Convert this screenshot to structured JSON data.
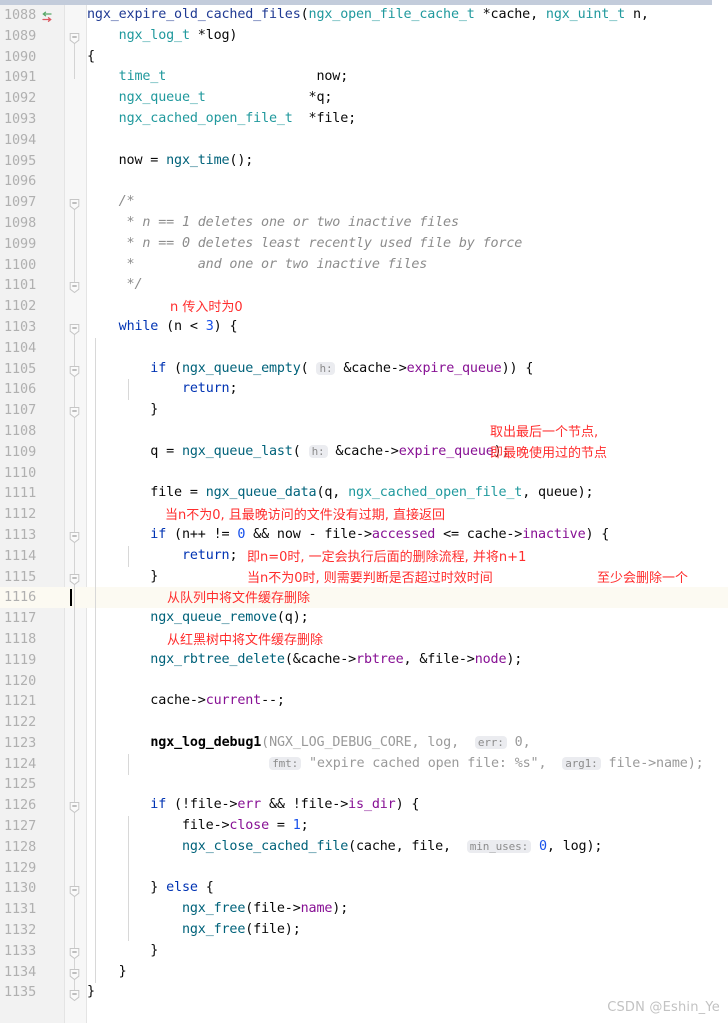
{
  "editor": {
    "language": "C",
    "watermark": "CSDN @Eshin_Ye",
    "first_line_number": 1088,
    "current_line_number": 1116,
    "gutter_icon": "show-usages-arrows-icon"
  },
  "lines": [
    {
      "n": "1088",
      "text": "ngx_expire_old_cached_files(ngx_open_file_cache_t *cache, ngx_uint_t n,"
    },
    {
      "n": "1089",
      "text": "    ngx_log_t *log)"
    },
    {
      "n": "1090",
      "text": "{"
    },
    {
      "n": "1091",
      "text": "    time_t                   now;"
    },
    {
      "n": "1092",
      "text": "    ngx_queue_t             *q;"
    },
    {
      "n": "1093",
      "text": "    ngx_cached_open_file_t  *file;"
    },
    {
      "n": "1094",
      "text": ""
    },
    {
      "n": "1095",
      "text": "    now = ngx_time();"
    },
    {
      "n": "1096",
      "text": ""
    },
    {
      "n": "1097",
      "text": "    /*"
    },
    {
      "n": "1098",
      "text": "     * n == 1 deletes one or two inactive files"
    },
    {
      "n": "1099",
      "text": "     * n == 0 deletes least recently used file by force"
    },
    {
      "n": "1100",
      "text": "     *        and one or two inactive files"
    },
    {
      "n": "1101",
      "text": "     */"
    },
    {
      "n": "1102",
      "text": ""
    },
    {
      "n": "1103",
      "text": "    while (n < 3) {"
    },
    {
      "n": "1104",
      "text": ""
    },
    {
      "n": "1105",
      "text": "        if (ngx_queue_empty( h: &cache->expire_queue)) {"
    },
    {
      "n": "1106",
      "text": "            return;"
    },
    {
      "n": "1107",
      "text": "        }"
    },
    {
      "n": "1108",
      "text": ""
    },
    {
      "n": "1109",
      "text": "        q = ngx_queue_last( h: &cache->expire_queue);"
    },
    {
      "n": "1110",
      "text": ""
    },
    {
      "n": "1111",
      "text": "        file = ngx_queue_data(q, ngx_cached_open_file_t, queue);"
    },
    {
      "n": "1112",
      "text": ""
    },
    {
      "n": "1113",
      "text": "        if (n++ != 0 && now - file->accessed <= cache->inactive) {"
    },
    {
      "n": "1114",
      "text": "            return;"
    },
    {
      "n": "1115",
      "text": "        }"
    },
    {
      "n": "1116",
      "text": ""
    },
    {
      "n": "1117",
      "text": "        ngx_queue_remove(q);"
    },
    {
      "n": "1118",
      "text": ""
    },
    {
      "n": "1119",
      "text": "        ngx_rbtree_delete(&cache->rbtree, &file->node);"
    },
    {
      "n": "1120",
      "text": ""
    },
    {
      "n": "1121",
      "text": "        cache->current--;"
    },
    {
      "n": "1122",
      "text": ""
    },
    {
      "n": "1123",
      "text": "        ngx_log_debug1(NGX_LOG_DEBUG_CORE, log,  err: 0,"
    },
    {
      "n": "1124",
      "text": "                       fmt: \"expire cached open file: %s\",  arg1: file->name);"
    },
    {
      "n": "1125",
      "text": ""
    },
    {
      "n": "1126",
      "text": "        if (!file->err && !file->is_dir) {"
    },
    {
      "n": "1127",
      "text": "            file->close = 1;"
    },
    {
      "n": "1128",
      "text": "            ngx_close_cached_file(cache, file,  min_uses: 0, log);"
    },
    {
      "n": "1129",
      "text": ""
    },
    {
      "n": "1130",
      "text": "        } else {"
    },
    {
      "n": "1131",
      "text": "            ngx_free(file->name);"
    },
    {
      "n": "1132",
      "text": "            ngx_free(file);"
    },
    {
      "n": "1133",
      "text": "        }"
    },
    {
      "n": "1134",
      "text": "    }"
    },
    {
      "n": "1135",
      "text": "}"
    }
  ],
  "inlay_hints": [
    {
      "label": "h:",
      "line": "1105"
    },
    {
      "label": "h:",
      "line": "1109"
    },
    {
      "label": "err:",
      "line": "1123"
    },
    {
      "label": "fmt:",
      "line": "1124"
    },
    {
      "label": "arg1:",
      "line": "1124"
    },
    {
      "label": "min_uses:",
      "line": "1128"
    }
  ],
  "annotations": [
    {
      "id": "a1",
      "text": "n 传入时为0",
      "line": "1102"
    },
    {
      "id": "a2",
      "text": "取出最后一个节点,",
      "line": "1108"
    },
    {
      "id": "a3",
      "text": "即最晚使用过的节点",
      "line": "1109"
    },
    {
      "id": "a4",
      "text": "当n不为0, 且最晚访问的文件没有过期, 直接返回",
      "line": "1112"
    },
    {
      "id": "a5",
      "text": "即n=0时, 一定会执行后面的删除流程, 并将n+1",
      "line": "1114"
    },
    {
      "id": "a6",
      "text": "当n不为0时, 则需要判断是否超过时效时间",
      "line": "1115"
    },
    {
      "id": "a7",
      "text": "至少会删除一个",
      "line": "1115"
    },
    {
      "id": "a8",
      "text": "从队列中将文件缓存删除",
      "line": "1116"
    },
    {
      "id": "a9",
      "text": "从红黑树中将文件缓存删除",
      "line": "1118"
    }
  ],
  "colors": {
    "keyword": "#0033b3",
    "function_declaration": "#1f3a93",
    "function_call": "#00627a",
    "type": "#20999d",
    "field": "#871094",
    "number": "#1750eb",
    "comment": "#8c8c8c",
    "annotation_red": "#ff2d2d",
    "current_line_bg": "#fcfaf2",
    "gutter_bg": "#f2f2f2",
    "scrollbar": "#c3ccdb",
    "watermark": "#c2c2c2"
  }
}
